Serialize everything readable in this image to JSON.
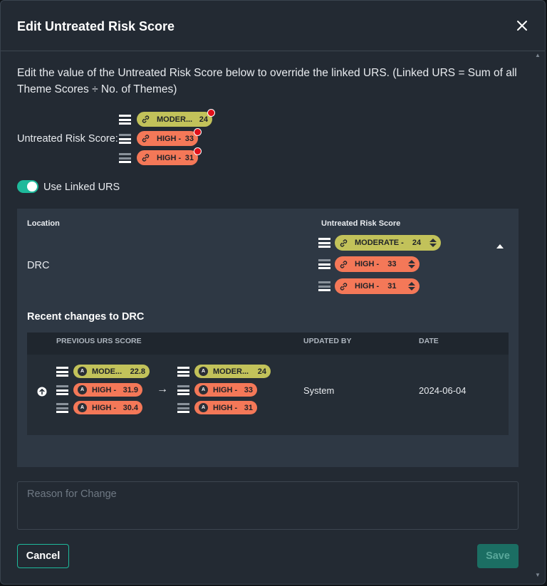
{
  "dialog": {
    "title": "Edit Untreated Risk Score",
    "description": "Edit the value of the Untreated Risk Score below to override the linked URS. (Linked URS = Sum of all Theme Scores ÷ No. of Themes)"
  },
  "urs_summary": {
    "label": "Untreated Risk Score:",
    "pills": [
      {
        "label": "MODER...",
        "value": "24",
        "level": "moderate",
        "icon": "link-icon",
        "flagged": true
      },
      {
        "label": "HIGH -",
        "value": "33",
        "level": "high",
        "icon": "link-icon",
        "flagged": true
      },
      {
        "label": "HIGH -",
        "value": "31",
        "level": "high",
        "icon": "link-icon",
        "flagged": true
      }
    ]
  },
  "linked_toggle": {
    "label": "Use Linked URS",
    "on": true
  },
  "table": {
    "location_header": "Location",
    "urs_header": "Untreated Risk Score",
    "row": {
      "location": "DRC",
      "pills": [
        {
          "label": "MODERATE -",
          "value": "24",
          "level": "moderate"
        },
        {
          "label": "HIGH -",
          "value": "33",
          "level": "high"
        },
        {
          "label": "HIGH -",
          "value": "31",
          "level": "high"
        }
      ]
    }
  },
  "recent_changes": {
    "title": "Recent changes to DRC",
    "headers": {
      "previous": "PREVIOUS URS SCORE",
      "updated_by": "UPDATED BY",
      "date": "DATE"
    },
    "entries": [
      {
        "previous": [
          {
            "label": "MODE...",
            "value": "22.8",
            "level": "moderate",
            "avatar": "A"
          },
          {
            "label": "HIGH -",
            "value": "31.9",
            "level": "high",
            "avatar": "A"
          },
          {
            "label": "HIGH -",
            "value": "30.4",
            "level": "high",
            "avatar": "A"
          }
        ],
        "arrow": "→",
        "current": [
          {
            "label": "MODER...",
            "value": "24",
            "level": "moderate",
            "avatar": "A"
          },
          {
            "label": "HIGH -",
            "value": "33",
            "level": "high",
            "avatar": "A"
          },
          {
            "label": "HIGH -",
            "value": "31",
            "level": "high",
            "avatar": "A"
          }
        ],
        "updated_by": "System",
        "date": "2024-06-04"
      }
    ]
  },
  "reason": {
    "placeholder": "Reason for Change",
    "value": ""
  },
  "footer": {
    "cancel": "Cancel",
    "save": "Save"
  },
  "colors": {
    "moderate": "#c2c25a",
    "high": "#f47858",
    "accent": "#1eb99b",
    "flag": "#e0101a"
  }
}
